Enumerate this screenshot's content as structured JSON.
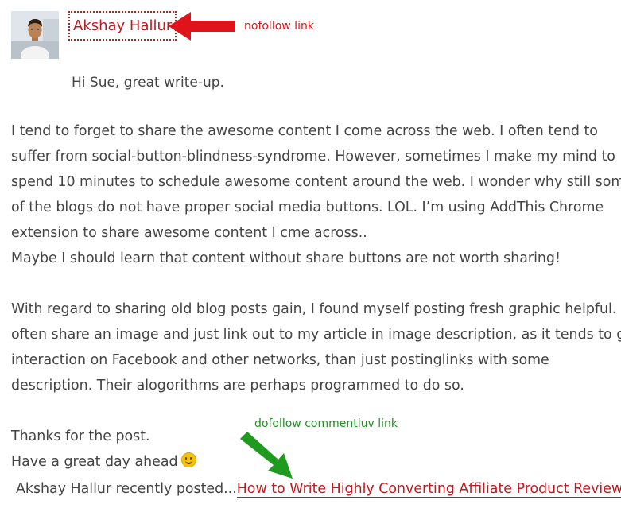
{
  "comment": {
    "author_name": "Akshay Hallur",
    "greeting": "Hi Sue, great write-up.",
    "paragraphs": [
      "I tend to forget to share the awesome content I come across the web. I often tend to",
      "suffer from social-button-blindness-syndrome. However, sometimes I make my mind to",
      "spend 10 minutes to schedule awesome content around the web. I wonder why still some",
      "of the blogs do not have proper social media buttons. LOL. I’m using AddThis Chrome",
      "extension to share awesome content I cme across..",
      "Maybe I should learn that content without share buttons are not worth sharing!",
      "",
      "With regard to sharing old blog posts gain, I found myself posting fresh graphic helpful. I",
      "often share an image and just link out to my article in image description, as it tends to get",
      "interaction on Facebook and other networks, than just postinglinks with some",
      "description. Their alogorithms are perhaps programmed to do so.",
      "",
      "Thanks for the post."
    ],
    "closing": "Have a great day ahead",
    "recently_posted_prefix": "Akshay Hallur recently posted...",
    "recently_posted_link": "How to Write Highly Converting Affiliate Product Reviews"
  },
  "annotations": {
    "nofollow_label": "nofollow link",
    "dofollow_label": "dofollow commentluv link"
  },
  "colors": {
    "link": "#c0191f",
    "nofollow_arrow": "#e0131b",
    "dofollow_arrow": "#1f9a1f",
    "body_text": "#444444"
  },
  "icons": {
    "avatar": "user-photo",
    "smiley": "smiley-emoji",
    "annotation_arrow_red": "arrow-left-icon",
    "annotation_arrow_green": "arrow-down-right-icon"
  }
}
